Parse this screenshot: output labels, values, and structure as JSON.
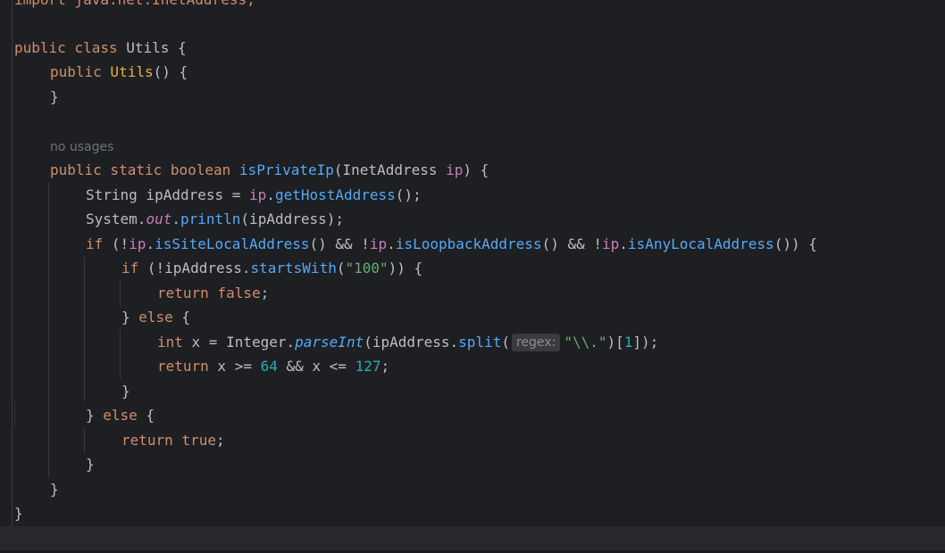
{
  "editor": {
    "lines": {
      "l0": {
        "t1": "import java.net.InetAddress;"
      },
      "l1": {
        "kw1": "public class",
        "t1": " Utils {"
      },
      "l2": {
        "kw1": "public",
        "fn1": " Utils",
        "t1": "() {"
      },
      "l3": {
        "t1": "}"
      },
      "usages": "no usages",
      "l4": {
        "kw1": "public static boolean",
        "fn1": " isPrivateIp",
        "t1": "(InetAddress ",
        "p1": "ip",
        "t2": ") {"
      },
      "l5": {
        "t1": "String ipAddress = ",
        "p1": "ip",
        "t2": ".",
        "fn1": "getHostAddress",
        "t3": "();"
      },
      "l6": {
        "t1": "System.",
        "f1": "out",
        "t2": ".",
        "fn1": "println",
        "t3": "(ipAddress);"
      },
      "l7": {
        "kw1": "if",
        "t1": " (!",
        "p1": "ip",
        "t2": ".",
        "fn1": "isSiteLocalAddress",
        "t3": "() && !",
        "p2": "ip",
        "t4": ".",
        "fn2": "isLoopbackAddress",
        "t5": "() && !",
        "p3": "ip",
        "t6": ".",
        "fn3": "isAnyLocalAddress",
        "t7": "()) {"
      },
      "l8": {
        "kw1": "if",
        "t1": " (!ipAddress.",
        "fn1": "startsWith",
        "t2": "(",
        "s1": "\"100\"",
        "t3": ")) {"
      },
      "l9": {
        "kw1": "return false",
        "t1": ";"
      },
      "l10": {
        "t1": "} ",
        "kw1": "else",
        "t2": " {"
      },
      "l11": {
        "kw1": "int",
        "t1": " x = Integer.",
        "fn1": "parseInt",
        "t2": "(ipAddress.",
        "fn2": "split",
        "t3": "(",
        "hint": "regex:",
        "s1": "\"\\\\.\"",
        "t4": ")[",
        "n1": "1",
        "t5": "]);"
      },
      "l12": {
        "kw1": "return",
        "t1": " x >= ",
        "n1": "64",
        "t2": " && x <= ",
        "n2": "127",
        "t3": ";"
      },
      "l13": {
        "t1": "}"
      },
      "l14": {
        "t1": "} ",
        "kw1": "else",
        "t2": " {"
      },
      "l15": {
        "kw1": "return true",
        "t1": ";"
      },
      "l16": {
        "t1": "}"
      },
      "l17": {
        "t1": "}"
      },
      "l18": {
        "t1": "}"
      }
    }
  }
}
